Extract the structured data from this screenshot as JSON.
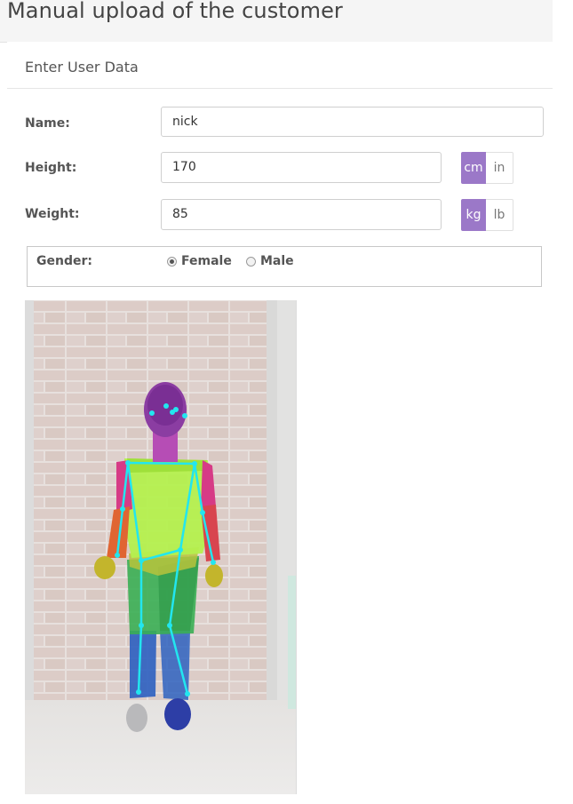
{
  "header": {
    "title": "Manual upload of the customer"
  },
  "panel": {
    "title": "Enter User Data"
  },
  "form": {
    "name": {
      "label": "Name:",
      "value": "nick"
    },
    "height": {
      "label": "Height:",
      "value": "170",
      "units": [
        "cm",
        "in"
      ],
      "selected_unit": "cm"
    },
    "weight": {
      "label": "Weight:",
      "value": "85",
      "units": [
        "kg",
        "lb"
      ],
      "selected_unit": "kg"
    },
    "gender": {
      "label": "Gender:",
      "options": [
        "Female",
        "Male"
      ],
      "selected": "Female"
    }
  },
  "colors": {
    "accent": "#9b78c8",
    "skeleton": "#22e6ef"
  }
}
